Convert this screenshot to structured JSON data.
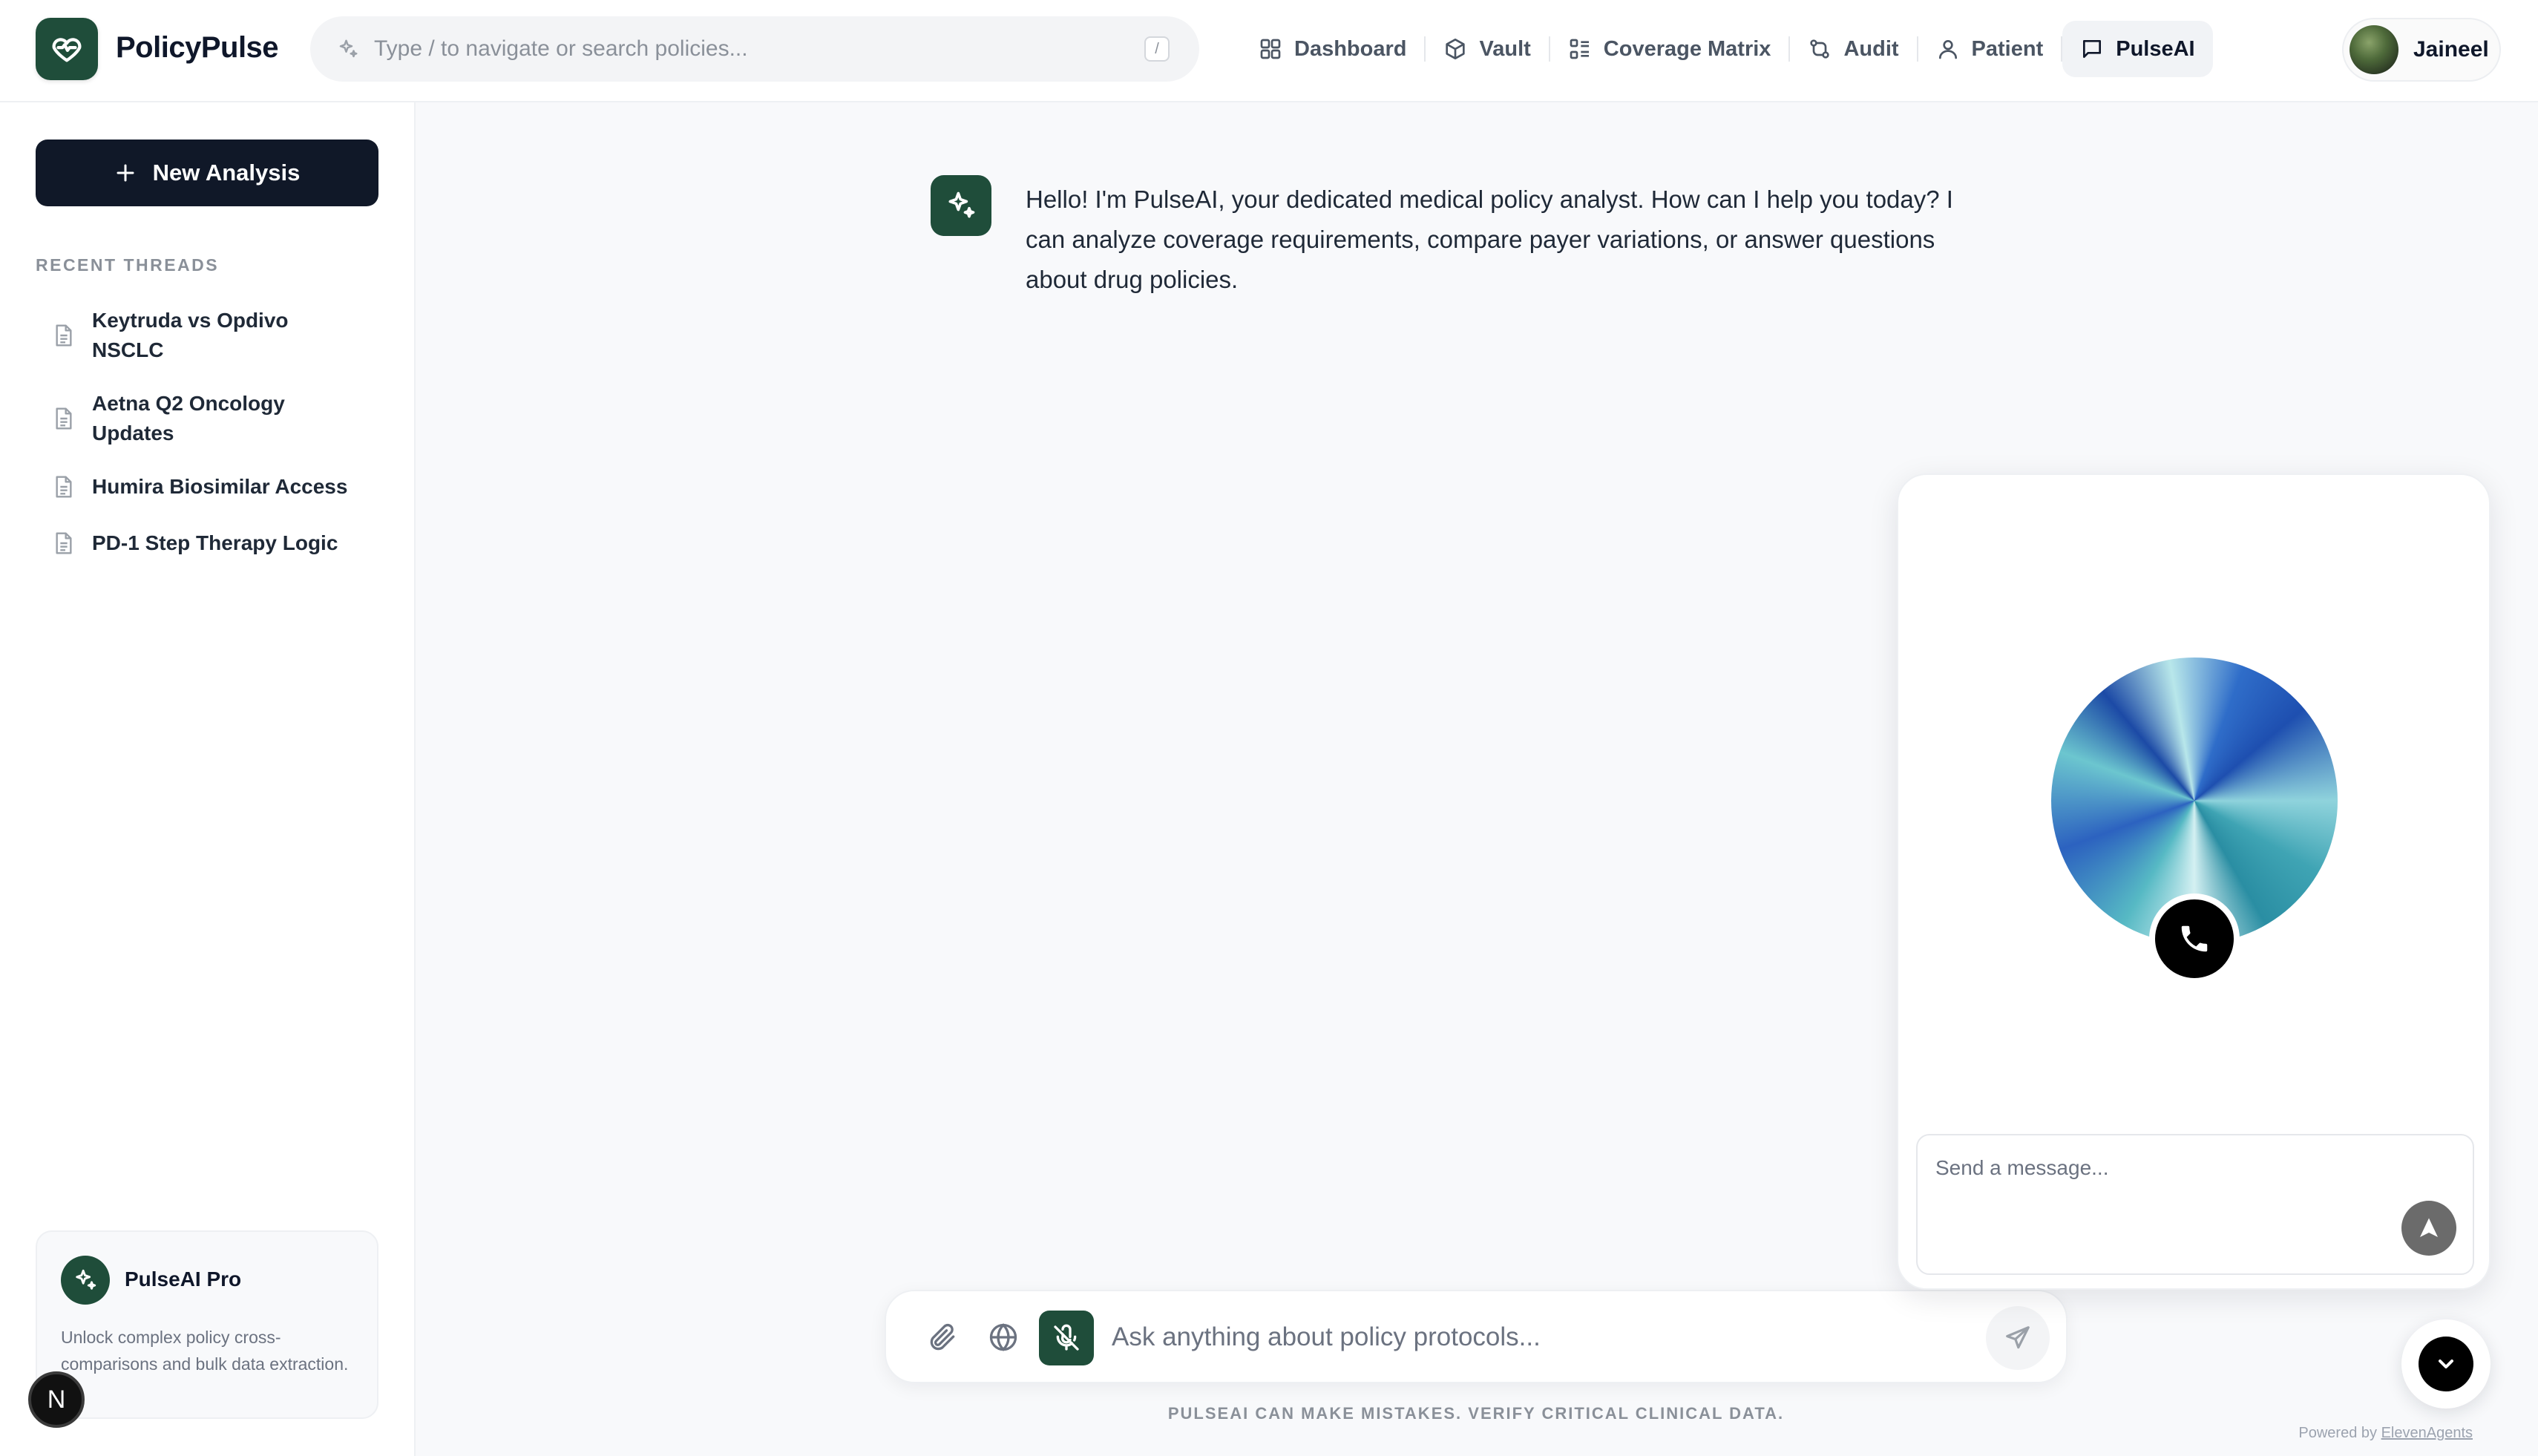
{
  "brand": {
    "name": "PolicyPulse"
  },
  "search": {
    "placeholder": "Type / to navigate or search policies...",
    "shortcut": "/"
  },
  "nav": {
    "items": [
      {
        "label": "Dashboard",
        "icon": "grid-icon"
      },
      {
        "label": "Vault",
        "icon": "cube-icon"
      },
      {
        "label": "Coverage Matrix",
        "icon": "list-grid-icon"
      },
      {
        "label": "Audit",
        "icon": "git-compare-icon"
      },
      {
        "label": "Patient",
        "icon": "user-icon"
      },
      {
        "label": "PulseAI",
        "icon": "chat-icon",
        "active": true
      }
    ]
  },
  "user": {
    "name": "Jaineel"
  },
  "sidebar": {
    "new_button": "New Analysis",
    "section_label": "RECENT THREADS",
    "threads": [
      {
        "label": "Keytruda vs Opdivo NSCLC"
      },
      {
        "label": "Aetna Q2 Oncology Updates"
      },
      {
        "label": "Humira Biosimilar Access"
      },
      {
        "label": "PD-1 Step Therapy Logic"
      }
    ],
    "pro": {
      "title": "PulseAI Pro",
      "description": "Unlock complex policy cross-comparisons and bulk data extraction."
    },
    "badge_letter": "N"
  },
  "chat": {
    "messages": [
      {
        "role": "assistant",
        "text": "Hello! I'm PulseAI, your dedicated medical policy analyst. How can I help you today? I can analyze coverage requirements, compare payer variations, or answer questions about drug policies."
      }
    ]
  },
  "composer": {
    "placeholder": "Ask anything about policy protocols...",
    "disclaimer": "PULSEAI CAN MAKE MISTAKES. VERIFY CRITICAL CLINICAL DATA."
  },
  "widget": {
    "input_placeholder": "Send a message...",
    "powered_prefix": "Powered by",
    "powered_link": "ElevenAgents"
  },
  "colors": {
    "brand_green": "#1f4d3a",
    "primary_dark": "#101828",
    "background": "#f8f9fb"
  }
}
